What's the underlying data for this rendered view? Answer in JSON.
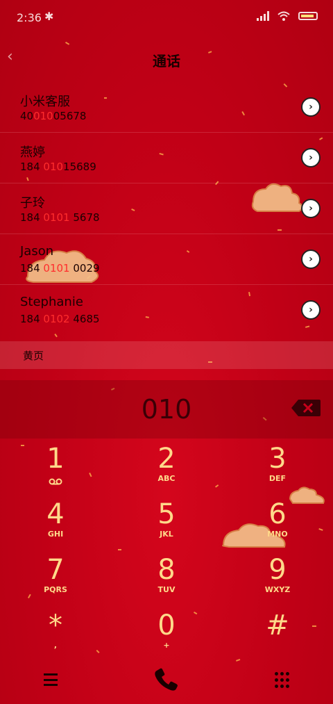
{
  "status_bar": {
    "time": "2:36",
    "bt_symbol": "✱"
  },
  "header": {
    "title": "通话",
    "back_symbol": "‹"
  },
  "contacts": [
    {
      "name": "小米客服",
      "num_pre": "40",
      "num_hl": "010",
      "num_post": "05678"
    },
    {
      "name": "燕婷",
      "num_pre": "184 ",
      "num_hl": "010",
      "num_post": "15689"
    },
    {
      "name": "子玲",
      "num_pre": "184 ",
      "num_hl": "0101",
      "num_post": " 5678"
    },
    {
      "name": "Jason",
      "num_pre": "184 ",
      "num_hl": "0101",
      "num_post": " 0029"
    },
    {
      "name": "Stephanie",
      "num_pre": "184 ",
      "num_hl": "0102",
      "num_post": " 4685"
    }
  ],
  "section": {
    "label": "黄页"
  },
  "dialer": {
    "number": "010"
  },
  "keypad": [
    {
      "digit": "1",
      "sub": ""
    },
    {
      "digit": "2",
      "sub": "ABC"
    },
    {
      "digit": "3",
      "sub": "DEF"
    },
    {
      "digit": "4",
      "sub": "GHI"
    },
    {
      "digit": "5",
      "sub": "JKL"
    },
    {
      "digit": "6",
      "sub": "MNO"
    },
    {
      "digit": "7",
      "sub": "PQRS"
    },
    {
      "digit": "8",
      "sub": "TUV"
    },
    {
      "digit": "9",
      "sub": "WXYZ"
    },
    {
      "digit": "*",
      "sub": ","
    },
    {
      "digit": "0",
      "sub": "+"
    },
    {
      "digit": "#",
      "sub": ""
    }
  ],
  "icons": {
    "contact_detail": "chevron-right-icon",
    "backspace": "backspace-icon",
    "voicemail": "voicemail-icon",
    "menu": "menu-icon",
    "call": "phone-icon",
    "dialpad": "dialpad-icon"
  },
  "colors": {
    "background": "#c8001a",
    "key_gold": "#ffd98a",
    "highlight": "#ff2d2d"
  }
}
